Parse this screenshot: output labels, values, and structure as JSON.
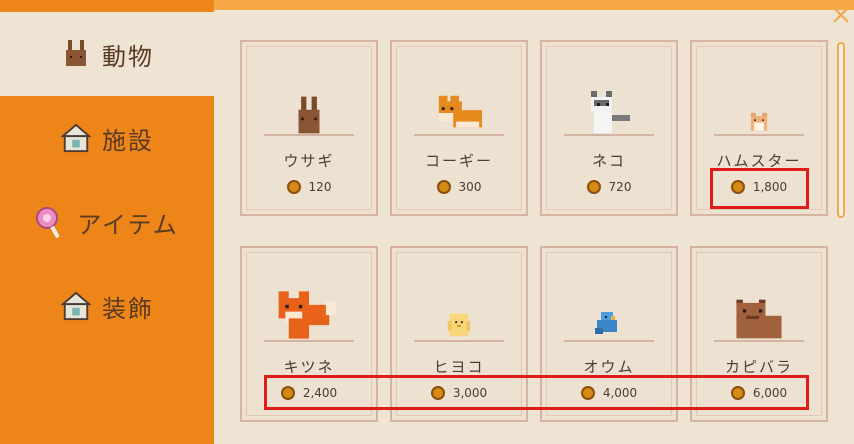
{
  "sidebar": {
    "tabs": [
      {
        "label": "動物",
        "icon": "rabbit-icon"
      },
      {
        "label": "施設",
        "icon": "house-icon"
      },
      {
        "label": "アイテム",
        "icon": "lollipop-icon"
      },
      {
        "label": "装飾",
        "icon": "house-icon"
      }
    ],
    "active_index": 0
  },
  "shop": {
    "items": [
      {
        "name": "ウサギ",
        "price": "120",
        "icon": "rabbit-icon"
      },
      {
        "name": "コーギー",
        "price": "300",
        "icon": "corgi-icon"
      },
      {
        "name": "ネコ",
        "price": "720",
        "icon": "cat-icon"
      },
      {
        "name": "ハムスター",
        "price": "1,800",
        "icon": "hamster-icon"
      },
      {
        "name": "キツネ",
        "price": "2,400",
        "icon": "fox-icon"
      },
      {
        "name": "ヒヨコ",
        "price": "3,000",
        "icon": "chick-icon"
      },
      {
        "name": "オウム",
        "price": "4,000",
        "icon": "parrot-icon"
      },
      {
        "name": "カピバラ",
        "price": "6,000",
        "icon": "capybara-icon"
      }
    ]
  },
  "colors": {
    "sidebar_bg": "#ee8519",
    "panel_bg": "#efe4d3",
    "card_border": "#d7b4a2",
    "highlight": "#e11a1a",
    "coin": "#d48a14"
  }
}
